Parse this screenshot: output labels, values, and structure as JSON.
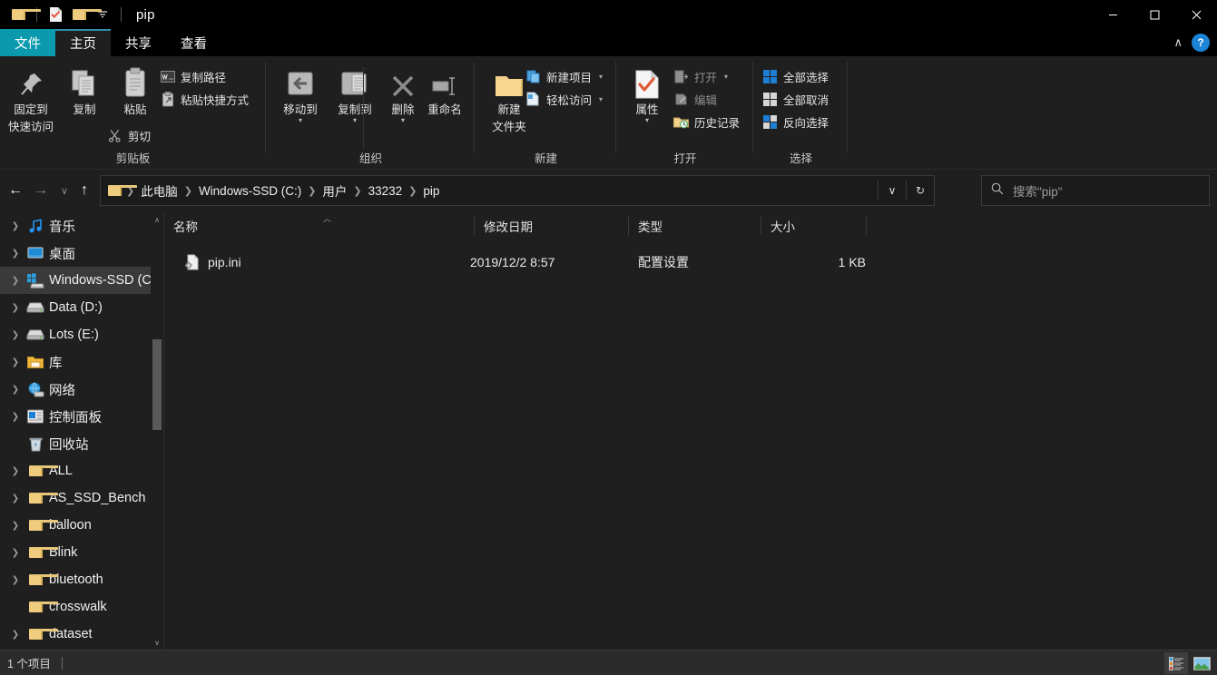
{
  "window": {
    "title": "pip",
    "quick_access": [
      {
        "name": "folder-icon",
        "label": "文件夹"
      },
      {
        "name": "properties-icon",
        "label": "属性"
      },
      {
        "name": "new-folder-icon",
        "label": "新建文件夹"
      },
      {
        "name": "chevron-down-icon",
        "label": "自定义快速访问工具栏"
      }
    ],
    "controls": {
      "minimize": "—",
      "maximize": "☐",
      "close": "✕"
    }
  },
  "ribbon": {
    "tabs": [
      {
        "label": "文件",
        "id": "file",
        "state": "file"
      },
      {
        "label": "主页",
        "id": "home",
        "state": "active"
      },
      {
        "label": "共享",
        "id": "share",
        "state": "normal"
      },
      {
        "label": "查看",
        "id": "view",
        "state": "normal"
      }
    ],
    "collapse_icon": "∧",
    "help_label": "?",
    "groups": [
      {
        "name": "clipboard",
        "label": "剪贴板",
        "big_buttons": [
          {
            "label_line1": "固定到",
            "label_line2": "快速访问",
            "icon": "pin-icon"
          },
          {
            "label_line1": "复制",
            "label_line2": "",
            "icon": "copy-icon"
          },
          {
            "label_line1": "粘贴",
            "label_line2": "",
            "icon": "paste-icon"
          }
        ],
        "small_buttons": [
          {
            "label": "复制路径",
            "icon": "copy-path-icon",
            "caret": false
          },
          {
            "label": "粘贴快捷方式",
            "icon": "paste-shortcut-icon",
            "caret": false
          },
          {
            "label": "剪切",
            "icon": "scissors-icon",
            "caret": false
          }
        ]
      },
      {
        "name": "organize",
        "label": "组织",
        "big_buttons": [
          {
            "label_line1": "移动到",
            "label_line2": "",
            "icon": "move-to-icon",
            "caret": true
          },
          {
            "label_line1": "复制到",
            "label_line2": "",
            "icon": "copy-to-icon",
            "caret": true
          },
          {
            "label_line1": "删除",
            "label_line2": "",
            "icon": "delete-icon",
            "caret": true
          },
          {
            "label_line1": "重命名",
            "label_line2": "",
            "icon": "rename-icon",
            "caret": false
          }
        ],
        "small_buttons": []
      },
      {
        "name": "new",
        "label": "新建",
        "big_buttons": [
          {
            "label_line1": "新建",
            "label_line2": "文件夹",
            "icon": "new-folder-icon"
          }
        ],
        "small_buttons": [
          {
            "label": "新建项目",
            "icon": "new-item-icon",
            "caret": true
          },
          {
            "label": "轻松访问",
            "icon": "easy-access-icon",
            "caret": true
          }
        ]
      },
      {
        "name": "open",
        "label": "打开",
        "big_buttons": [
          {
            "label_line1": "属性",
            "label_line2": "",
            "icon": "properties-icon",
            "caret": true
          }
        ],
        "small_buttons": [
          {
            "label": "打开",
            "icon": "open-icon",
            "caret": true
          },
          {
            "label": "编辑",
            "icon": "edit-icon",
            "caret": false
          },
          {
            "label": "历史记录",
            "icon": "history-icon",
            "caret": false
          }
        ]
      },
      {
        "name": "select",
        "label": "选择",
        "big_buttons": [],
        "small_buttons": [
          {
            "label": "全部选择",
            "icon": "select-all-icon",
            "caret": false
          },
          {
            "label": "全部取消",
            "icon": "select-none-icon",
            "caret": false
          },
          {
            "label": "反向选择",
            "icon": "invert-selection-icon",
            "caret": false
          }
        ]
      }
    ]
  },
  "navigation": {
    "back_icon": "←",
    "forward_icon": "→",
    "recent_icon": "∨",
    "up_icon": "↑",
    "breadcrumbs": [
      "此电脑",
      "Windows-SSD (C:)",
      "用户",
      "33232",
      "pip"
    ],
    "dropdown_icon": "∨",
    "refresh_icon": "↻"
  },
  "search": {
    "placeholder": "搜索\"pip\"",
    "icon": "search-icon"
  },
  "sidebar": {
    "scroll_up_icon": "∧",
    "scroll_down_icon": "∨",
    "items": [
      {
        "label": "音乐",
        "icon": "music-icon",
        "expandable": true,
        "selected": false
      },
      {
        "label": "桌面",
        "icon": "desktop-icon",
        "expandable": true,
        "selected": false
      },
      {
        "label": "Windows-SSD (C:)",
        "icon": "windows-drive-icon",
        "expandable": true,
        "selected": true
      },
      {
        "label": "Data (D:)",
        "icon": "drive-icon",
        "expandable": true,
        "selected": false
      },
      {
        "label": "Lots (E:)",
        "icon": "drive-icon",
        "expandable": true,
        "selected": false
      },
      {
        "label": "库",
        "icon": "library-icon",
        "expandable": true,
        "selected": false
      },
      {
        "label": "网络",
        "icon": "network-icon",
        "expandable": true,
        "selected": false
      },
      {
        "label": "控制面板",
        "icon": "control-panel-icon",
        "expandable": true,
        "selected": false
      },
      {
        "label": "回收站",
        "icon": "recycle-bin-icon",
        "expandable": false,
        "selected": false
      },
      {
        "label": "ALL",
        "icon": "folder-icon",
        "expandable": true,
        "selected": false
      },
      {
        "label": "AS_SSD_Bench",
        "icon": "folder-icon",
        "expandable": true,
        "selected": false
      },
      {
        "label": "balloon",
        "icon": "folder-icon",
        "expandable": true,
        "selected": false
      },
      {
        "label": "Blink",
        "icon": "folder-icon",
        "expandable": true,
        "selected": false
      },
      {
        "label": "bluetooth",
        "icon": "folder-icon",
        "expandable": true,
        "selected": false
      },
      {
        "label": "crosswalk",
        "icon": "folder-icon",
        "expandable": false,
        "selected": false
      },
      {
        "label": "dataset",
        "icon": "folder-icon",
        "expandable": true,
        "selected": false
      }
    ]
  },
  "filelist": {
    "columns": [
      {
        "label": "名称",
        "sorted": true
      },
      {
        "label": "修改日期",
        "sorted": false
      },
      {
        "label": "类型",
        "sorted": false
      },
      {
        "label": "大小",
        "sorted": false
      }
    ],
    "rows": [
      {
        "name": "pip.ini",
        "modified": "2019/12/2 8:57",
        "type": "配置设置",
        "size": "1 KB",
        "icon": "config-file-icon"
      }
    ]
  },
  "statusbar": {
    "item_count": "1 个项目",
    "views": [
      {
        "name": "details-view-button",
        "active": true
      },
      {
        "name": "large-icons-view-button",
        "active": false
      }
    ]
  },
  "colors": {
    "accent": "#0b9aad",
    "background": "#1f1f1f",
    "titlebar": "#000000",
    "selection": "#3a3a3a",
    "folder_yellow": "#f0cd7e",
    "help_blue": "#1b84d6"
  }
}
